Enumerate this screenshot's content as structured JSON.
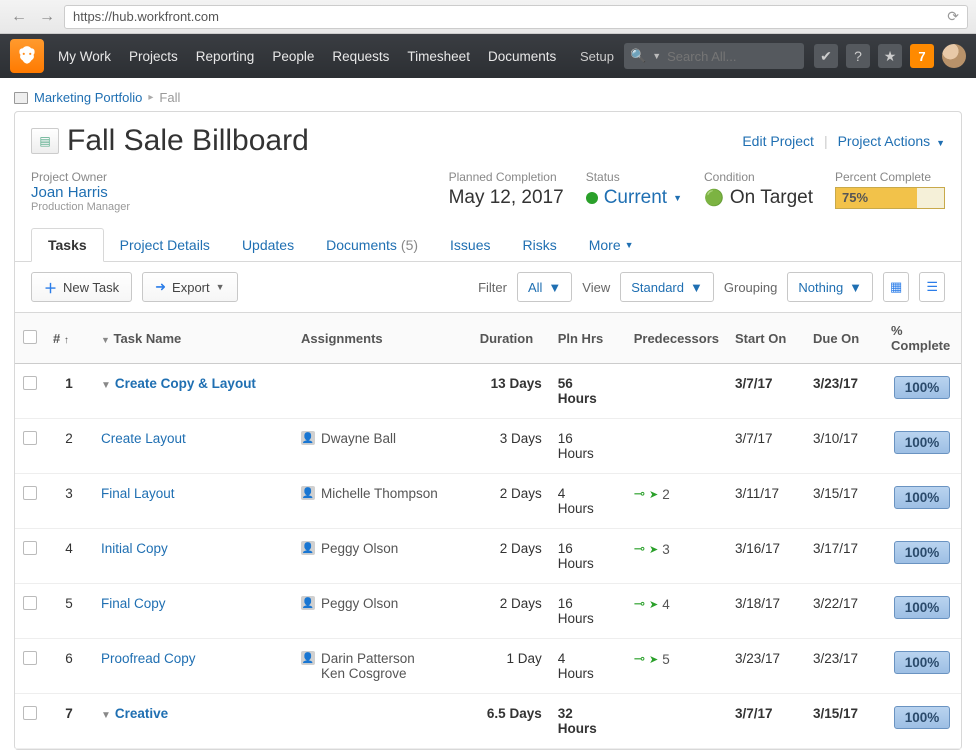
{
  "browser": {
    "url": "https://hub.workfront.com"
  },
  "topnav": {
    "links": [
      "My Work",
      "Projects",
      "Reporting",
      "People",
      "Requests",
      "Timesheet",
      "Documents"
    ],
    "setup": "Setup",
    "search_placeholder": "Search All...",
    "notif_count": "7"
  },
  "breadcrumb": {
    "root": "Marketing Portfolio",
    "current": "Fall"
  },
  "project": {
    "title": "Fall Sale Billboard",
    "edit": "Edit Project",
    "actions": "Project Actions",
    "owner_lbl": "Project Owner",
    "owner_name": "Joan Harris",
    "owner_role": "Production Manager",
    "planned_lbl": "Planned Completion",
    "planned_val": "May 12, 2017",
    "status_lbl": "Status",
    "status_val": "Current",
    "cond_lbl": "Condition",
    "cond_val": "On Target",
    "pct_lbl": "Percent Complete",
    "pct_val": "75%",
    "pct_fill": 75
  },
  "tabs": {
    "tasks": "Tasks",
    "details": "Project Details",
    "updates": "Updates",
    "documents": "Documents",
    "documents_count": "(5)",
    "issues": "Issues",
    "risks": "Risks",
    "more": "More"
  },
  "toolbar": {
    "new_task": "New Task",
    "export": "Export",
    "filter_lbl": "Filter",
    "filter_val": "All",
    "view_lbl": "View",
    "view_val": "Standard",
    "group_lbl": "Grouping",
    "group_val": "Nothing"
  },
  "columns": {
    "num": "#",
    "name": "Task Name",
    "assign": "Assignments",
    "dur": "Duration",
    "pln": "Pln Hrs",
    "pred": "Predecessors",
    "start": "Start On",
    "due": "Due On",
    "pct": "% Complete"
  },
  "rows": [
    {
      "n": "1",
      "name": "Create Copy & Layout",
      "assign": [],
      "dur": "13 Days",
      "pln": "56 Hours",
      "pred": "",
      "start": "3/7/17",
      "due": "3/23/17",
      "pct": "100%",
      "bold": true,
      "expand": true
    },
    {
      "n": "2",
      "name": "Create Layout",
      "assign": [
        "Dwayne Ball"
      ],
      "dur": "3 Days",
      "pln": "16 Hours",
      "pred": "",
      "start": "3/7/17",
      "due": "3/10/17",
      "pct": "100%"
    },
    {
      "n": "3",
      "name": "Final Layout",
      "assign": [
        "Michelle Thompson"
      ],
      "dur": "2 Days",
      "pln": "4 Hours",
      "pred": "2",
      "start": "3/11/17",
      "due": "3/15/17",
      "pct": "100%"
    },
    {
      "n": "4",
      "name": "Initial Copy",
      "assign": [
        "Peggy Olson"
      ],
      "dur": "2 Days",
      "pln": "16 Hours",
      "pred": "3",
      "start": "3/16/17",
      "due": "3/17/17",
      "pct": "100%"
    },
    {
      "n": "5",
      "name": "Final Copy",
      "assign": [
        "Peggy Olson"
      ],
      "dur": "2 Days",
      "pln": "16 Hours",
      "pred": "4",
      "start": "3/18/17",
      "due": "3/22/17",
      "pct": "100%"
    },
    {
      "n": "6",
      "name": "Proofread Copy",
      "assign": [
        "Darin Patterson",
        "Ken Cosgrove"
      ],
      "dur": "1 Day",
      "pln": "4 Hours",
      "pred": "5",
      "start": "3/23/17",
      "due": "3/23/17",
      "pct": "100%"
    },
    {
      "n": "7",
      "name": "Creative",
      "assign": [],
      "dur": "6.5 Days",
      "pln": "32 Hours",
      "pred": "",
      "start": "3/7/17",
      "due": "3/15/17",
      "pct": "100%",
      "bold": true,
      "expand": true
    }
  ]
}
